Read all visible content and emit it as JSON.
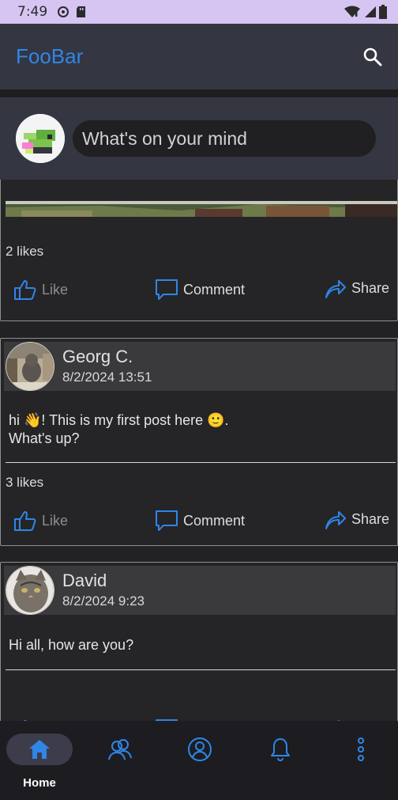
{
  "status_bar": {
    "time": "7:49"
  },
  "app_bar": {
    "title": "FooBar",
    "search_icon": "search-icon"
  },
  "composer": {
    "placeholder": "What's on your mind"
  },
  "posts": [
    {
      "likes": "2 likes",
      "actions": {
        "like": "Like",
        "comment": "Comment",
        "share": "Share"
      }
    },
    {
      "author": "Georg C.",
      "timestamp": "8/2/2024 13:51",
      "text_line1": "hi 👋! This is my first post here 🙂.",
      "text_line2": "What's up?",
      "likes": "3 likes",
      "actions": {
        "like": "Like",
        "comment": "Comment",
        "share": "Share"
      }
    },
    {
      "author": "David",
      "timestamp": "8/2/2024 9:23",
      "text_line1": "Hi all, how are you?"
    }
  ],
  "bottom_nav": {
    "items": [
      {
        "icon": "home-icon",
        "label": "Home",
        "selected": true
      },
      {
        "icon": "friends-icon"
      },
      {
        "icon": "profile-icon"
      },
      {
        "icon": "bell-icon"
      },
      {
        "icon": "more-vert-icon"
      }
    ]
  },
  "colors": {
    "accent": "#2f86e8",
    "app_bar": "#343641",
    "background": "#222224",
    "status_bar": "#d6c4f2"
  }
}
